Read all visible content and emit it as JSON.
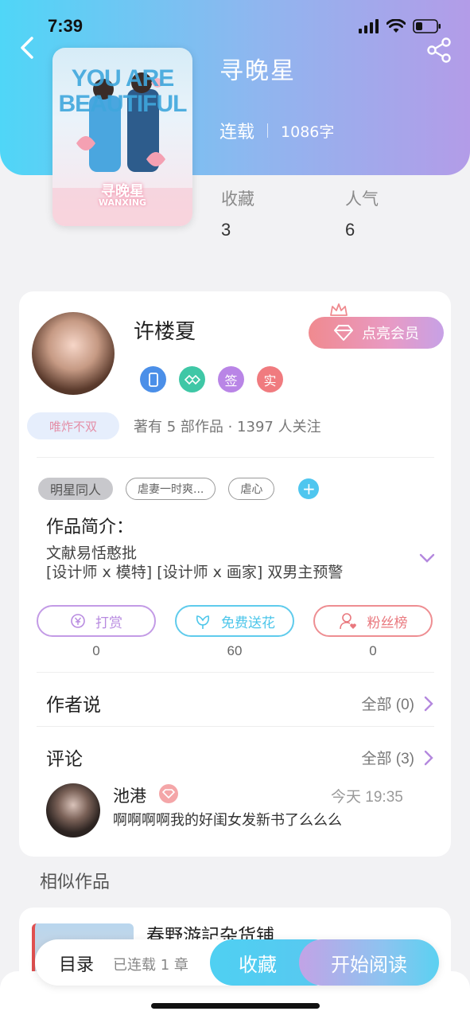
{
  "status_bar": {
    "time": "7:39"
  },
  "book": {
    "title": "寻晚星",
    "status": "连载",
    "word_count": "1086字",
    "cover": {
      "line1": "YOU ARE",
      "line2": "BEAUTIFUL",
      "name": "寻晚星",
      "sub": "WANXING"
    },
    "stats": [
      {
        "label": "收藏",
        "value": "3"
      },
      {
        "label": "人气",
        "value": "6"
      }
    ]
  },
  "author": {
    "name": "许楼夏",
    "vip_label": "点亮会员",
    "badges": [
      "",
      "",
      "签",
      "实"
    ],
    "tagline": "唯炸不双",
    "stats_text": "著有 5 部作品 · 1397 人关注"
  },
  "tags": [
    "明星同人",
    "虐妻一时爽...",
    "虐心"
  ],
  "intro": {
    "label": "作品简介：",
    "lines": [
      "文献易恬憨批",
      "[设计师 x 模特] [设计师 x 画家] 双男主预警"
    ]
  },
  "actions": [
    {
      "label": "打赏",
      "count": "0",
      "color": "#b88be0"
    },
    {
      "label": "免费送花",
      "count": "60",
      "color": "#4cc6ea"
    },
    {
      "label": "粉丝榜",
      "count": "0",
      "color": "#e9787e"
    }
  ],
  "author_says": {
    "title": "作者说",
    "link": "全部 (0)"
  },
  "comments": {
    "title": "评论",
    "link": "全部 (3)",
    "items": [
      {
        "user": "池港",
        "time": "今天 19:35",
        "text": "啊啊啊啊我的好闺女发新书了么么么"
      }
    ]
  },
  "similar": {
    "title": "相似作品",
    "items": [
      {
        "name": "春野游記杂货铺"
      }
    ]
  },
  "bottom_bar": {
    "toc": "目录",
    "toc_sub": "已连载 1 章",
    "fav": "收藏",
    "read": "开始阅读"
  }
}
